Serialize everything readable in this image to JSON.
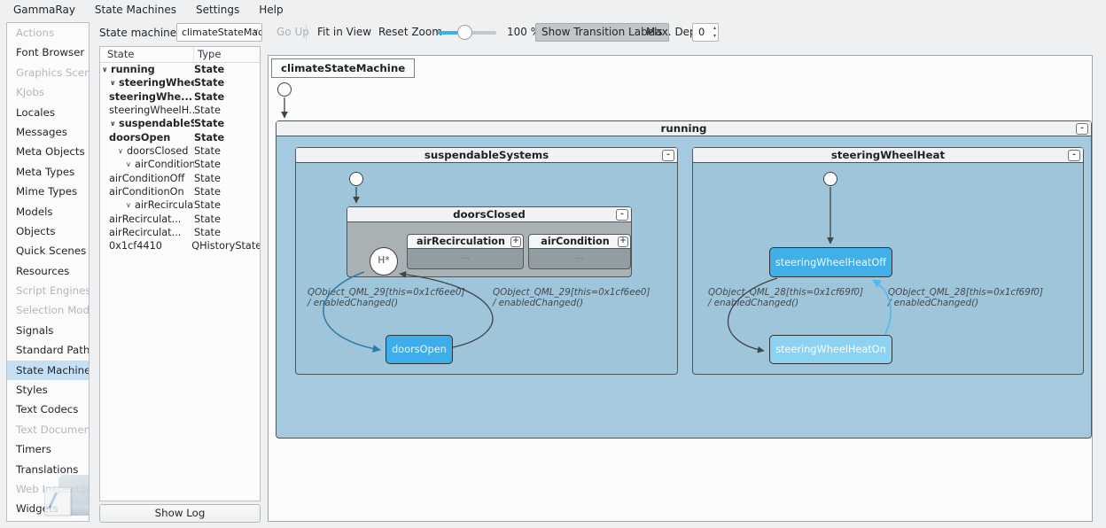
{
  "menu": {
    "items": [
      "GammaRay",
      "State Machines",
      "Settings",
      "Help"
    ]
  },
  "toolbar": {
    "state_machine_label": "State machine:",
    "state_machine_value": "climateStateMachir",
    "go_up": "Go Up",
    "fit_in_view": "Fit in View",
    "reset_zoom": "Reset Zoom",
    "zoom_value": "100 %",
    "show_transition_labels": "Show Transition Labels",
    "max_depth_label": "Max. Depth:",
    "max_depth_value": "0"
  },
  "sidebar": {
    "items": [
      {
        "label": "Actions",
        "enabled": false,
        "selected": false
      },
      {
        "label": "Font Browser",
        "enabled": true,
        "selected": false
      },
      {
        "label": "Graphics Scenes",
        "enabled": false,
        "selected": false
      },
      {
        "label": "KJobs",
        "enabled": false,
        "selected": false
      },
      {
        "label": "Locales",
        "enabled": true,
        "selected": false
      },
      {
        "label": "Messages",
        "enabled": true,
        "selected": false
      },
      {
        "label": "Meta Objects",
        "enabled": true,
        "selected": false
      },
      {
        "label": "Meta Types",
        "enabled": true,
        "selected": false
      },
      {
        "label": "Mime Types",
        "enabled": true,
        "selected": false
      },
      {
        "label": "Models",
        "enabled": true,
        "selected": false
      },
      {
        "label": "Objects",
        "enabled": true,
        "selected": false
      },
      {
        "label": "Quick Scenes",
        "enabled": true,
        "selected": false
      },
      {
        "label": "Resources",
        "enabled": true,
        "selected": false
      },
      {
        "label": "Script Engines",
        "enabled": false,
        "selected": false
      },
      {
        "label": "Selection Models",
        "enabled": false,
        "selected": false
      },
      {
        "label": "Signals",
        "enabled": true,
        "selected": false
      },
      {
        "label": "Standard Paths",
        "enabled": true,
        "selected": false
      },
      {
        "label": "State Machines",
        "enabled": true,
        "selected": true
      },
      {
        "label": "Styles",
        "enabled": true,
        "selected": false
      },
      {
        "label": "Text Codecs",
        "enabled": true,
        "selected": false
      },
      {
        "label": "Text Documents",
        "enabled": false,
        "selected": false
      },
      {
        "label": "Timers",
        "enabled": true,
        "selected": false
      },
      {
        "label": "Translations",
        "enabled": true,
        "selected": false
      },
      {
        "label": "Web Inspector",
        "enabled": false,
        "selected": false
      },
      {
        "label": "Widgets",
        "enabled": true,
        "selected": false
      }
    ]
  },
  "tree": {
    "columns": [
      "State",
      "Type"
    ],
    "rows": [
      {
        "label": "running",
        "type": "State",
        "depth": 0,
        "expanded": true,
        "bold": true
      },
      {
        "label": "steeringWheel...",
        "type": "State",
        "depth": 1,
        "expanded": true,
        "bold": true
      },
      {
        "label": "steeringWhe...",
        "type": "State",
        "depth": 2,
        "expanded": false,
        "bold": true
      },
      {
        "label": "steeringWheelH...",
        "type": "State",
        "depth": 2,
        "expanded": false,
        "bold": false
      },
      {
        "label": "suspendableS...",
        "type": "State",
        "depth": 1,
        "expanded": true,
        "bold": true
      },
      {
        "label": "doorsOpen",
        "type": "State",
        "depth": 2,
        "expanded": false,
        "bold": true
      },
      {
        "label": "doorsClosed",
        "type": "State",
        "depth": 2,
        "expanded": true,
        "bold": false
      },
      {
        "label": "airCondition",
        "type": "State",
        "depth": 3,
        "expanded": true,
        "bold": false
      },
      {
        "label": "airConditionOff",
        "type": "State",
        "depth": 4,
        "expanded": false,
        "bold": false
      },
      {
        "label": "airConditionOn",
        "type": "State",
        "depth": 4,
        "expanded": false,
        "bold": false
      },
      {
        "label": "airRecirculation",
        "type": "State",
        "depth": 3,
        "expanded": true,
        "bold": false
      },
      {
        "label": "airRecirculat...",
        "type": "State",
        "depth": 4,
        "expanded": false,
        "bold": false
      },
      {
        "label": "airRecirculat...",
        "type": "State",
        "depth": 4,
        "expanded": false,
        "bold": false
      },
      {
        "label": "0x1cf4410",
        "type": "QHistoryState",
        "depth": 3,
        "expanded": false,
        "bold": false
      }
    ]
  },
  "show_log_label": "Show Log",
  "diagram": {
    "machine_label": "climateStateMachine",
    "states": {
      "running": "running",
      "suspendableSystems": "suspendableSystems",
      "steeringWheelHeat": "steeringWheelHeat",
      "doorsClosed": "doorsClosed",
      "airRecirculation": "airRecirculation",
      "airCondition": "airCondition",
      "doorsOpen": "doorsOpen",
      "steeringWheelHeatOff": "steeringWheelHeatOff",
      "steeringWheelHeatOn": "steeringWheelHeatOn",
      "history": "H*"
    },
    "collapsed_placeholder": "...",
    "transitions": {
      "susp_left": {
        "guard": "QObject_QML_29[this=0x1cf6ee0]",
        "action": "/ enabledChanged()"
      },
      "susp_right": {
        "guard": "QObject_QML_29[this=0x1cf6ee0]",
        "action": "/ enabledChanged()"
      },
      "steer_left": {
        "guard": "QObject_QML_28[this=0x1cf69f0]",
        "action": "/ enabledChanged()"
      },
      "steer_right": {
        "guard": "QObject_QML_28[this=0x1cf69f0]",
        "action": "/ enabledChanged()"
      }
    },
    "colors": {
      "accent": "#3daee9",
      "region_fill": "#a5c9de",
      "active_state_fill": "#3daee9",
      "current_state_fill": "#8ed2f2",
      "collapsed_region_fill": "#97a1a6",
      "highlight_edge": "#2d7ca8",
      "highlight_edge_light": "#4fb8ee"
    }
  }
}
